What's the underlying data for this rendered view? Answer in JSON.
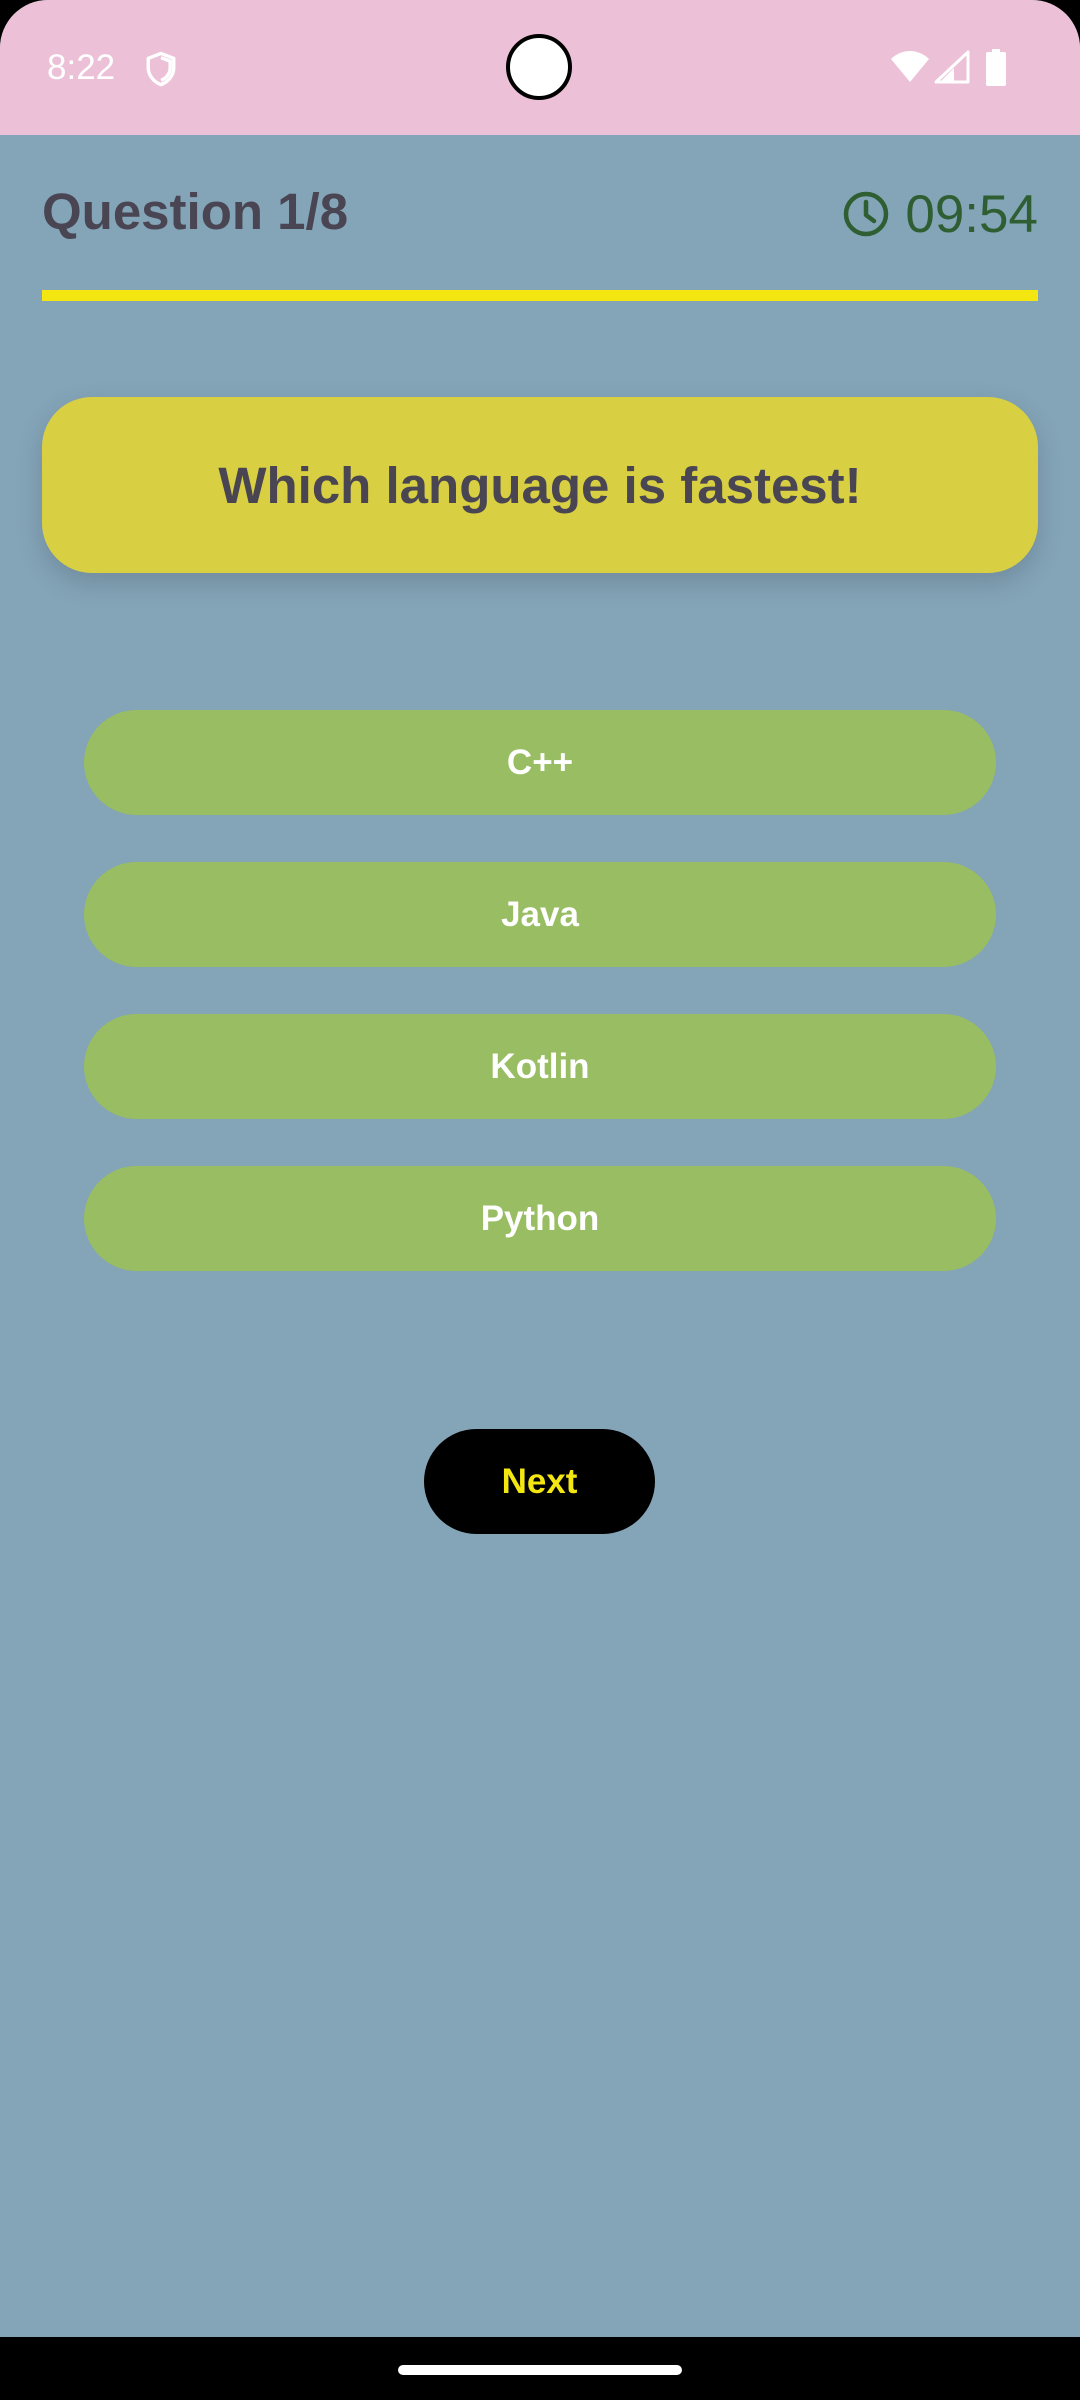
{
  "status_bar": {
    "time": "8:22",
    "icons": [
      "shield-icon",
      "wifi-icon",
      "signal-icon",
      "battery-icon"
    ]
  },
  "quiz": {
    "counter": "Question 1/8",
    "timer": "09:54",
    "progress": 1.0,
    "question": "Which language is fastest!",
    "options": [
      "C++",
      "Java",
      "Kotlin",
      "Python"
    ],
    "next_label": "Next"
  },
  "colors": {
    "background": "#84a4b8",
    "status_bar": "#ecc1d7",
    "question_card": "#d8d042",
    "option": "#98bd62",
    "accent_yellow": "#f4e711",
    "timer_green": "#2e5e32"
  }
}
